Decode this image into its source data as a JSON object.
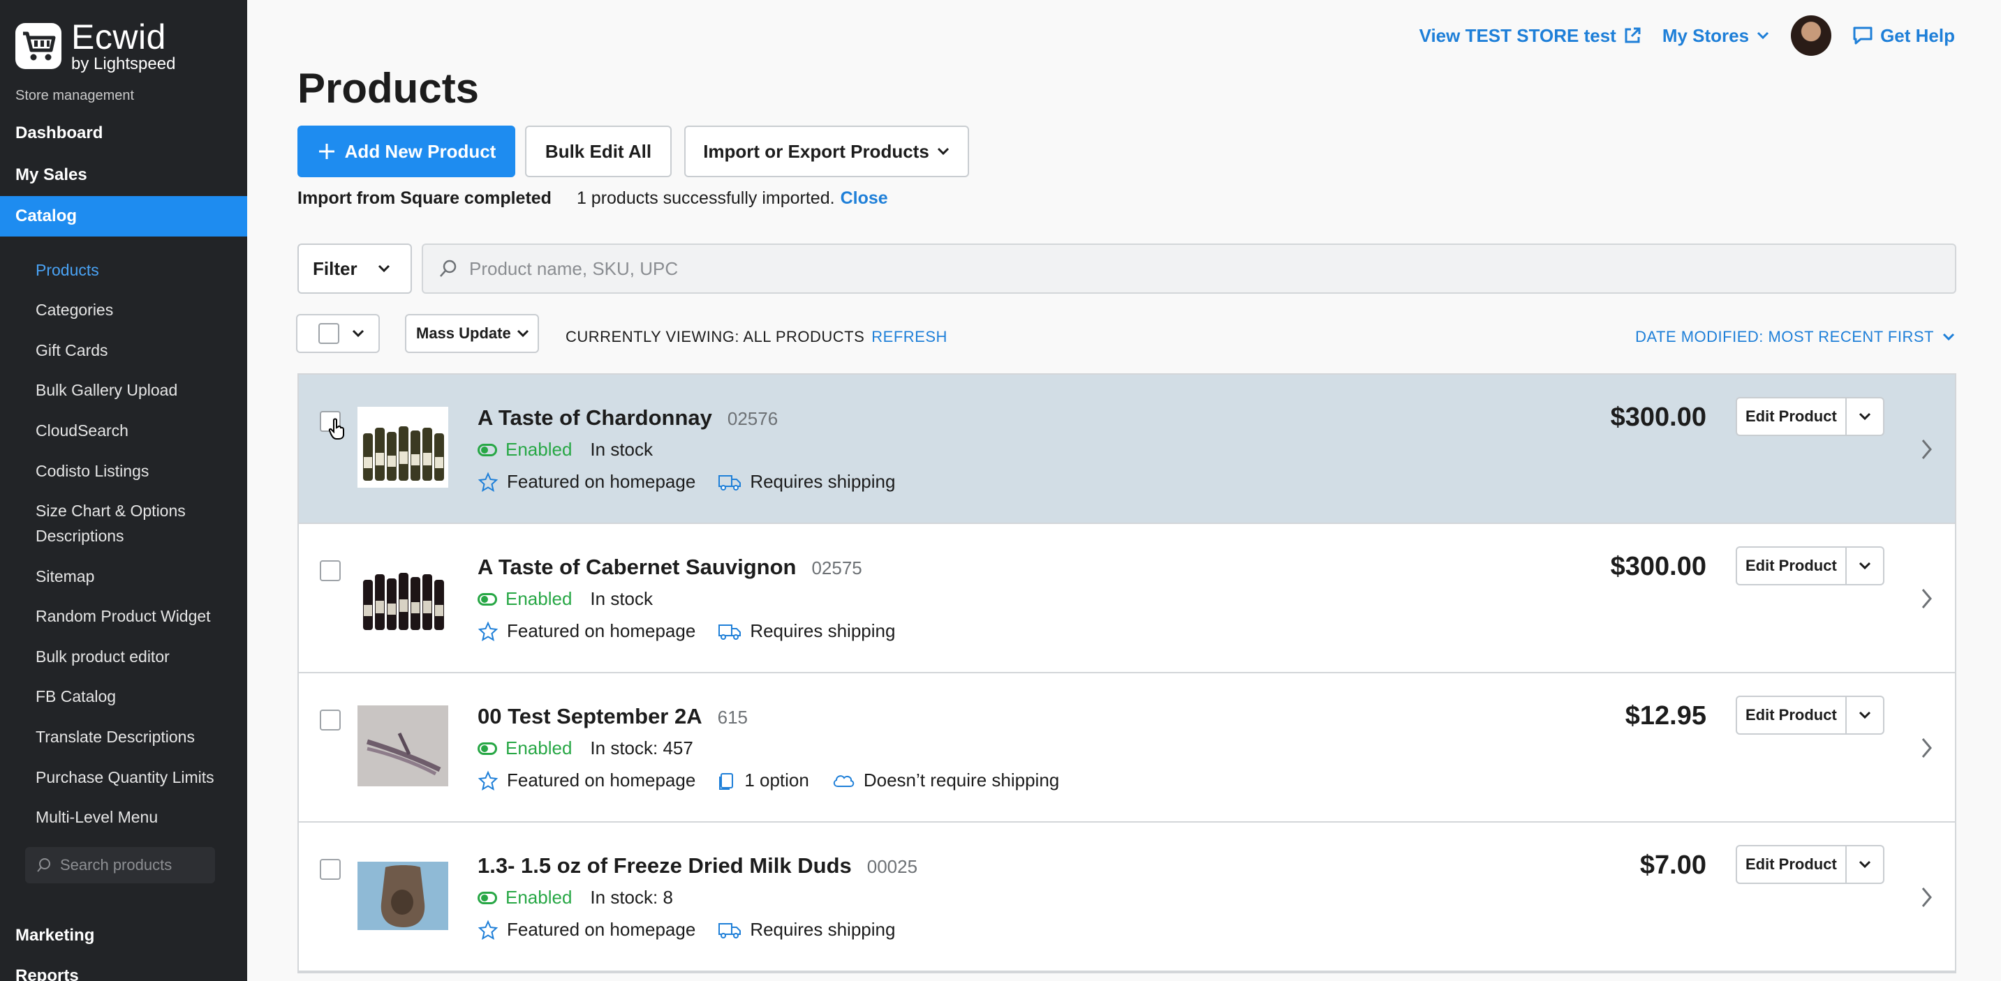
{
  "brand": {
    "name": "Ecwid",
    "sub": "by Lightspeed"
  },
  "sidebar": {
    "section_label": "Store management",
    "main_items": [
      {
        "label": "Dashboard"
      },
      {
        "label": "My Sales"
      },
      {
        "label": "Catalog",
        "active": true
      }
    ],
    "sub_items": [
      {
        "label": "Products",
        "active": true
      },
      {
        "label": "Categories"
      },
      {
        "label": "Gift Cards"
      },
      {
        "label": "Bulk Gallery Upload"
      },
      {
        "label": "CloudSearch"
      },
      {
        "label": "Codisto Listings"
      },
      {
        "label": "Size Chart & Options"
      },
      {
        "label": "Descriptions"
      },
      {
        "label": "Sitemap"
      },
      {
        "label": "Random Product Widget"
      },
      {
        "label": "Bulk product editor"
      },
      {
        "label": "FB Catalog"
      },
      {
        "label": "Translate Descriptions"
      },
      {
        "label": "Purchase Quantity Limits"
      },
      {
        "label": "Multi-Level Menu"
      }
    ],
    "search_placeholder": "Search products",
    "bottom_items": [
      {
        "label": "Marketing"
      },
      {
        "label": "Reports"
      }
    ]
  },
  "topbar": {
    "view_store": "View TEST STORE test",
    "my_stores": "My Stores",
    "get_help": "Get Help"
  },
  "page": {
    "title": "Products",
    "add_new": "Add New Product",
    "bulk_edit": "Bulk Edit All",
    "import_export": "Import or Export Products",
    "import_status": "Import from Square completed",
    "import_message": "1 products successfully imported.",
    "import_close": "Close",
    "filter": "Filter",
    "search_placeholder": "Product name, SKU, UPC",
    "mass_update": "Mass Update",
    "viewing": "CURRENTLY VIEWING: ALL PRODUCTS",
    "refresh": "REFRESH",
    "sort": "DATE MODIFIED: MOST RECENT FIRST",
    "edit_label": "Edit Product"
  },
  "products": [
    {
      "name": "A Taste of Chardonnay",
      "sku": "02576",
      "status": "Enabled",
      "stock": "In stock",
      "featured": "Featured on homepage",
      "feature2": "Requires shipping",
      "feature3": "",
      "price": "$300.00"
    },
    {
      "name": "A Taste of Cabernet Sauvignon",
      "sku": "02575",
      "status": "Enabled",
      "stock": "In stock",
      "featured": "Featured on homepage",
      "feature2": "Requires shipping",
      "feature3": "",
      "price": "$300.00"
    },
    {
      "name": "00 Test September 2A",
      "sku": "615",
      "status": "Enabled",
      "stock": "In stock: 457",
      "featured": "Featured on homepage",
      "feature2": "1 option",
      "feature3": "Doesn’t require shipping",
      "price": "$12.95"
    },
    {
      "name": "1.3- 1.5 oz of Freeze Dried Milk Duds",
      "sku": "00025",
      "status": "Enabled",
      "stock": "In stock: 8",
      "featured": "Featured on homepage",
      "feature2": "Requires shipping",
      "feature3": "",
      "price": "$7.00"
    }
  ],
  "colors": {
    "accent": "#1e8cf0",
    "link": "#1e7fd8",
    "enabled": "#27a745",
    "sidebar": "#222427"
  }
}
